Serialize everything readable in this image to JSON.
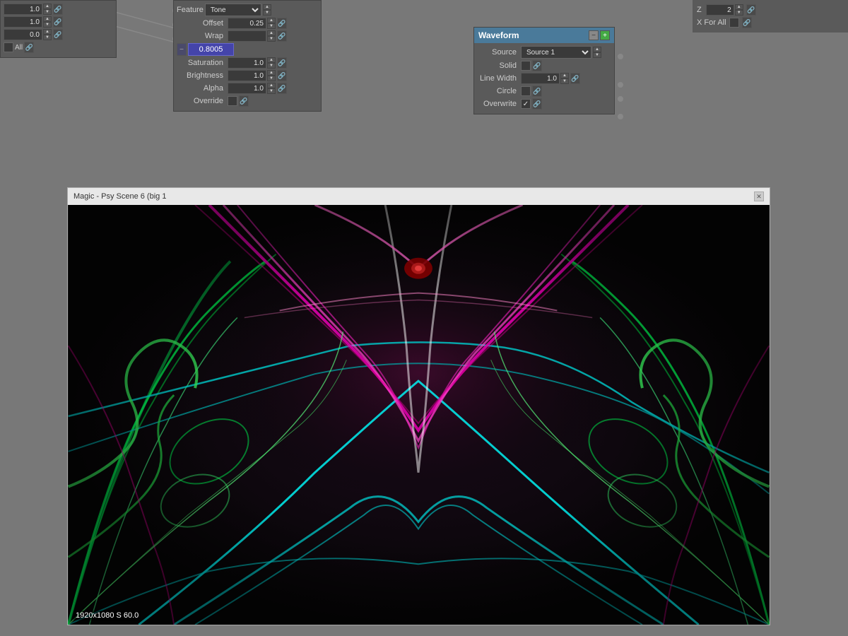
{
  "left_panel": {
    "rows": [
      {
        "value": "1.0"
      },
      {
        "value": "1.0"
      },
      {
        "value": "0.0"
      }
    ],
    "bottom_label": "All",
    "chain_symbol": "🔗"
  },
  "center_panel": {
    "feature_label": "Feature",
    "feature_value": "Tone",
    "offset_label": "Offset",
    "offset_value": "0.25",
    "wrap_label": "Wrap",
    "wrap_value": "",
    "blue_value": "0.8005",
    "saturation_label": "Saturation",
    "saturation_value": "1.0",
    "brightness_label": "Brightness",
    "brightness_value": "1.0",
    "alpha_label": "Alpha",
    "alpha_value": "1.0",
    "override_label": "Override"
  },
  "waveform_panel": {
    "title": "Waveform",
    "source_label": "Source",
    "source_value": "Source 1",
    "solid_label": "Solid",
    "line_width_label": "Line Width",
    "line_width_value": "1.0",
    "circle_label": "Circle",
    "overwrite_label": "Overwrite",
    "overwrite_checked": true
  },
  "top_right": {
    "z_label": "Z",
    "z_value": "2",
    "x_for_all_label": "X For All"
  },
  "preview": {
    "title": "Magic - Psy Scene 6 (big 1",
    "info": "1920x1080 S 60.0"
  }
}
